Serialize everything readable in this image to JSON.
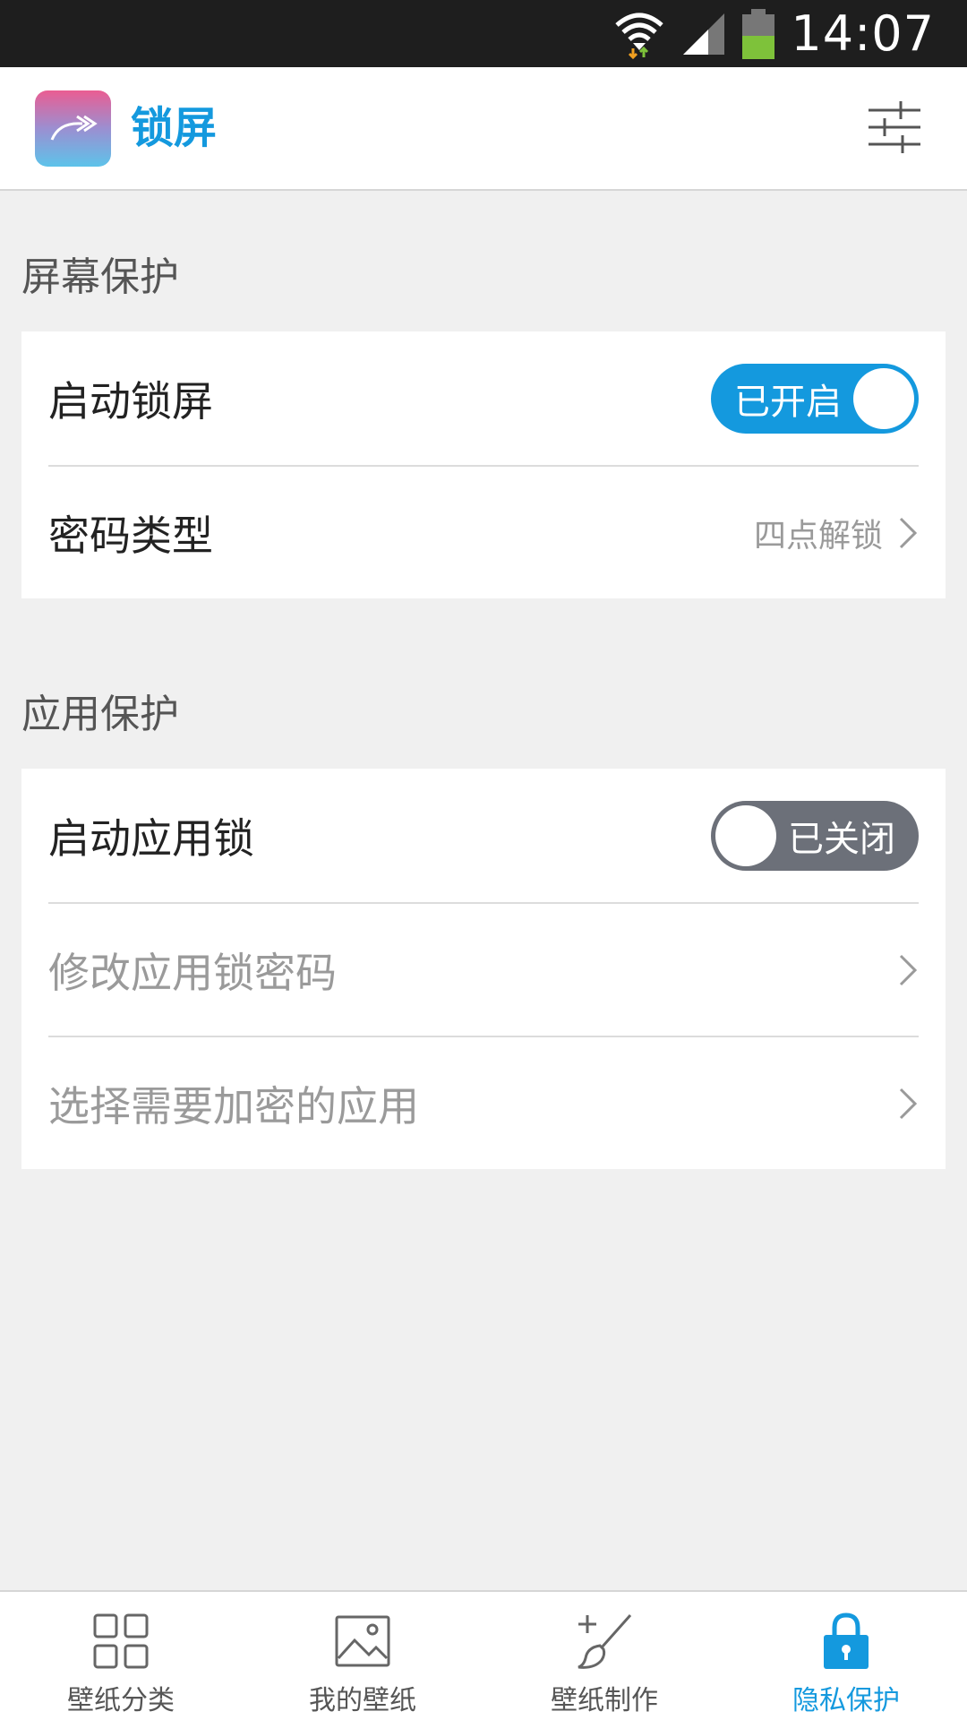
{
  "status_bar": {
    "time": "14:07",
    "icons": [
      "wifi-icon",
      "signal-icon",
      "battery-icon"
    ]
  },
  "header": {
    "title": "锁屏",
    "logo_icon": "share-arrow-icon",
    "settings_icon": "sliders-icon"
  },
  "screen_protection": {
    "title": "屏幕保护",
    "lock_screen": {
      "label": "启动锁屏",
      "toggle_text": "已开启",
      "enabled": true
    },
    "password_type": {
      "label": "密码类型",
      "value": "四点解锁"
    }
  },
  "app_protection": {
    "title": "应用保护",
    "app_lock": {
      "label": "启动应用锁",
      "toggle_text": "已关闭",
      "enabled": false
    },
    "change_password": {
      "label": "修改应用锁密码"
    },
    "select_apps": {
      "label": "选择需要加密的应用"
    }
  },
  "bottom_nav": {
    "items": [
      {
        "label": "壁纸分类",
        "icon": "grid-icon",
        "active": false
      },
      {
        "label": "我的壁纸",
        "icon": "image-icon",
        "active": false
      },
      {
        "label": "壁纸制作",
        "icon": "brush-icon",
        "active": false
      },
      {
        "label": "隐私保护",
        "icon": "lock-icon",
        "active": true
      }
    ]
  },
  "colors": {
    "accent": "#1499de",
    "toggle_off": "#6c7079",
    "background": "#f0f0f0"
  }
}
